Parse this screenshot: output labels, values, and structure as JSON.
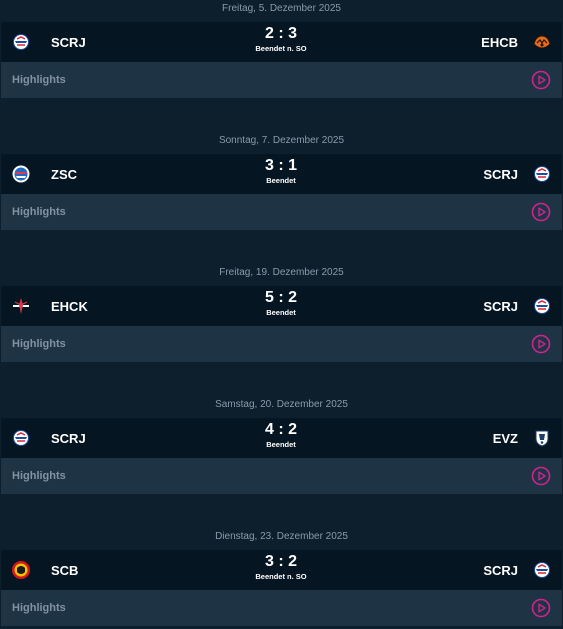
{
  "icons": {
    "play": "play-circle-icon"
  },
  "colors": {
    "background": "#0d1f2d",
    "score_row": "#061522",
    "highlights_row": "#1e3344",
    "accent": "#d0238f"
  },
  "games": [
    {
      "date": "Freitag, 5. Dezember 2025",
      "home": {
        "abbr": "SCRJ",
        "logo": "scrj-logo"
      },
      "away": {
        "abbr": "EHCB",
        "logo": "ehcb-logo"
      },
      "score": "2 : 3",
      "status": "Beendet n. SO",
      "highlights_label": "Highlights"
    },
    {
      "date": "Sonntag, 7. Dezember 2025",
      "home": {
        "abbr": "ZSC",
        "logo": "zsc-logo"
      },
      "away": {
        "abbr": "SCRJ",
        "logo": "scrj-logo"
      },
      "score": "3 : 1",
      "status": "Beendet",
      "highlights_label": "Highlights"
    },
    {
      "date": "Freitag, 19. Dezember 2025",
      "home": {
        "abbr": "EHCK",
        "logo": "ehck-logo"
      },
      "away": {
        "abbr": "SCRJ",
        "logo": "scrj-logo"
      },
      "score": "5 : 2",
      "status": "Beendet",
      "highlights_label": "Highlights"
    },
    {
      "date": "Samstag, 20. Dezember 2025",
      "home": {
        "abbr": "SCRJ",
        "logo": "scrj-logo"
      },
      "away": {
        "abbr": "EVZ",
        "logo": "evz-logo"
      },
      "score": "4 : 2",
      "status": "Beendet",
      "highlights_label": "Highlights"
    },
    {
      "date": "Dienstag, 23. Dezember 2025",
      "home": {
        "abbr": "SCB",
        "logo": "scb-logo"
      },
      "away": {
        "abbr": "SCRJ",
        "logo": "scrj-logo"
      },
      "score": "3 : 2",
      "status": "Beendet n. SO",
      "highlights_label": "Highlights"
    }
  ]
}
